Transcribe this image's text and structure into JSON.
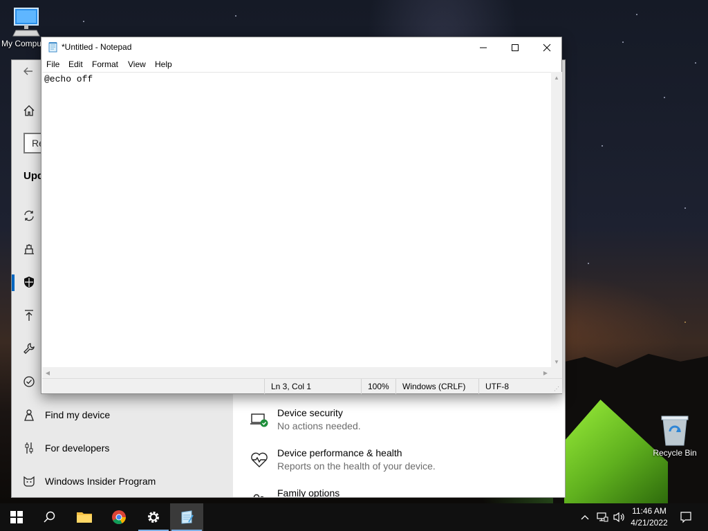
{
  "desktop": {
    "icons": [
      {
        "label": "My Computer"
      },
      {
        "label": "Recycle Bin"
      }
    ]
  },
  "settings": {
    "search_value": "Re",
    "section_heading": "Upd",
    "nav_items": [
      {
        "label": "",
        "icon": "sync-icon"
      },
      {
        "label": "",
        "icon": "delivery-optimization-icon"
      },
      {
        "label": "",
        "icon": "shield-icon",
        "active": true
      },
      {
        "label": "",
        "icon": "backup-upload-icon"
      },
      {
        "label": "",
        "icon": "wrench-icon"
      },
      {
        "label": "",
        "icon": "activation-check-icon"
      },
      {
        "label": "Find my device",
        "icon": "person-location-icon"
      },
      {
        "label": "For developers",
        "icon": "developer-sliders-icon"
      },
      {
        "label": "Windows Insider Program",
        "icon": "insider-cat-icon"
      }
    ],
    "main_items": [
      {
        "title": "Device security",
        "desc": "No actions needed.",
        "icon": "laptop-check-icon"
      },
      {
        "title": "Device performance & health",
        "desc": "Reports on the health of your device.",
        "icon": "heart-pulse-icon"
      },
      {
        "title": "Family options",
        "desc": "",
        "icon": "family-icon"
      }
    ]
  },
  "notepad": {
    "title": "*Untitled - Notepad",
    "menu": [
      "File",
      "Edit",
      "Format",
      "View",
      "Help"
    ],
    "content": "@echo off",
    "status": {
      "position": "Ln 3, Col 1",
      "zoom": "100%",
      "line_ending": "Windows (CRLF)",
      "encoding": "UTF-8"
    }
  },
  "taskbar": {
    "time": "11:46 AM",
    "date": "4/21/2022"
  },
  "colors": {
    "accent": "#0067c0",
    "taskbar": "#101010",
    "secondary_text": "#6b6b6b"
  }
}
